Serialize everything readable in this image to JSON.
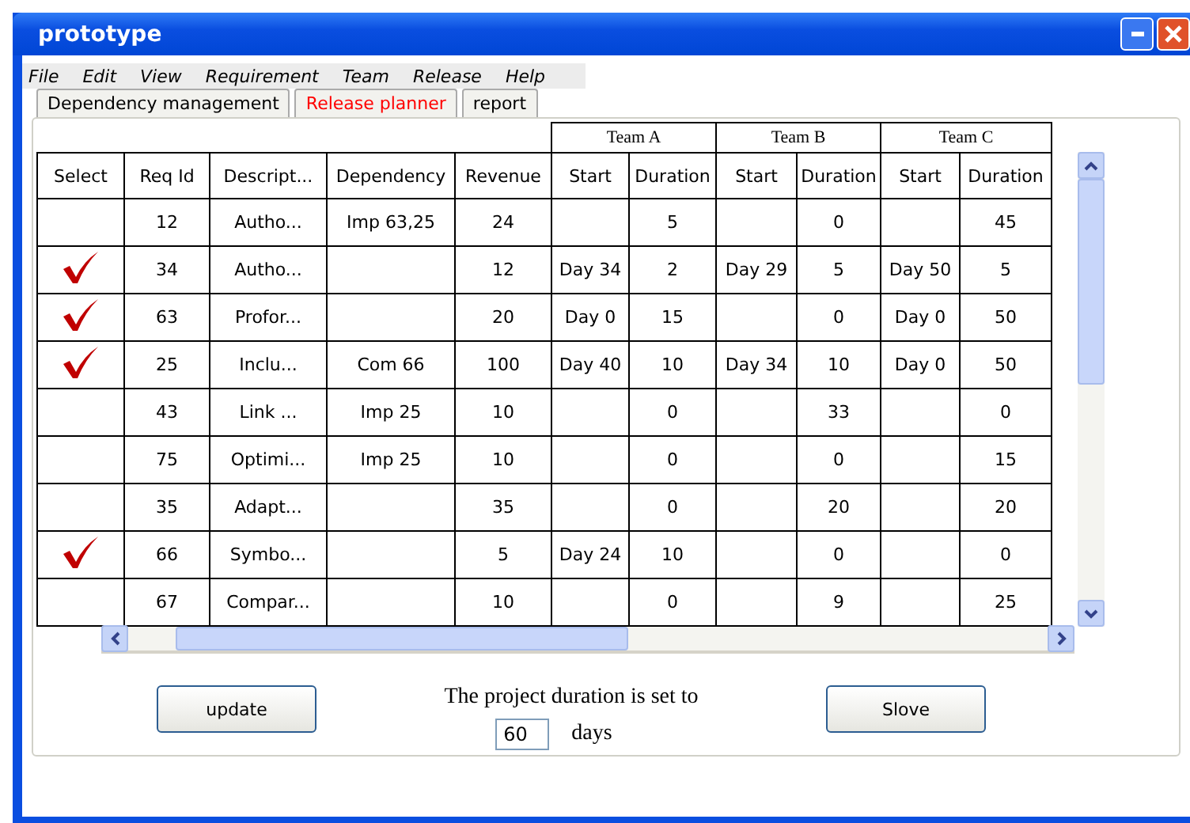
{
  "window": {
    "title": "prototype"
  },
  "menu": [
    "File",
    "Edit",
    "View",
    "Requirement",
    "Team",
    "Release",
    "Help"
  ],
  "tabs": [
    {
      "label": "Dependency management",
      "selected": false
    },
    {
      "label": "Release planner",
      "selected": true
    },
    {
      "label": "report",
      "selected": false
    }
  ],
  "table": {
    "column_groups": [
      "Team A",
      "Team B",
      "Team C"
    ],
    "columns": [
      "Select",
      "Req Id",
      "Descript...",
      "Dependency",
      "Revenue",
      "Start",
      "Duration",
      "Start",
      "Duration",
      "Start",
      "Duration"
    ],
    "rows": [
      {
        "checked": false,
        "cells": [
          "",
          "12",
          "Autho...",
          "Imp 63,25",
          "24",
          "",
          "5",
          "",
          "0",
          "",
          "45"
        ]
      },
      {
        "checked": true,
        "cells": [
          "",
          "34",
          "Autho...",
          "",
          "12",
          "Day 34",
          "2",
          "Day 29",
          "5",
          "Day 50",
          "5"
        ]
      },
      {
        "checked": true,
        "cells": [
          "",
          "63",
          "Profor...",
          "",
          "20",
          "Day 0",
          "15",
          "",
          "0",
          "Day 0",
          "50"
        ]
      },
      {
        "checked": true,
        "cells": [
          "",
          "25",
          "Inclu...",
          "Com 66",
          "100",
          "Day 40",
          "10",
          "Day 34",
          "10",
          "Day 0",
          "50"
        ]
      },
      {
        "checked": false,
        "cells": [
          "",
          "43",
          "Link ...",
          "Imp 25",
          "10",
          "",
          "0",
          "",
          "33",
          "",
          "0"
        ]
      },
      {
        "checked": false,
        "cells": [
          "",
          "75",
          "Optimi...",
          "Imp 25",
          "10",
          "",
          "0",
          "",
          "0",
          "",
          "15"
        ]
      },
      {
        "checked": false,
        "cells": [
          "",
          "35",
          "Adapt...",
          "",
          "35",
          "",
          "0",
          "",
          "20",
          "",
          "20"
        ]
      },
      {
        "checked": true,
        "cells": [
          "",
          "66",
          "Symbo...",
          "",
          "5",
          "Day 24",
          "10",
          "",
          "0",
          "",
          "0"
        ]
      },
      {
        "checked": false,
        "cells": [
          "",
          "67",
          "Compar...",
          "",
          "10",
          "",
          "0",
          "",
          "9",
          "",
          "25"
        ]
      }
    ]
  },
  "footer": {
    "update_button": "update",
    "duration_label": "The project duration is set to",
    "duration_value": "60",
    "duration_unit": "days",
    "solve_button": "Slove"
  }
}
